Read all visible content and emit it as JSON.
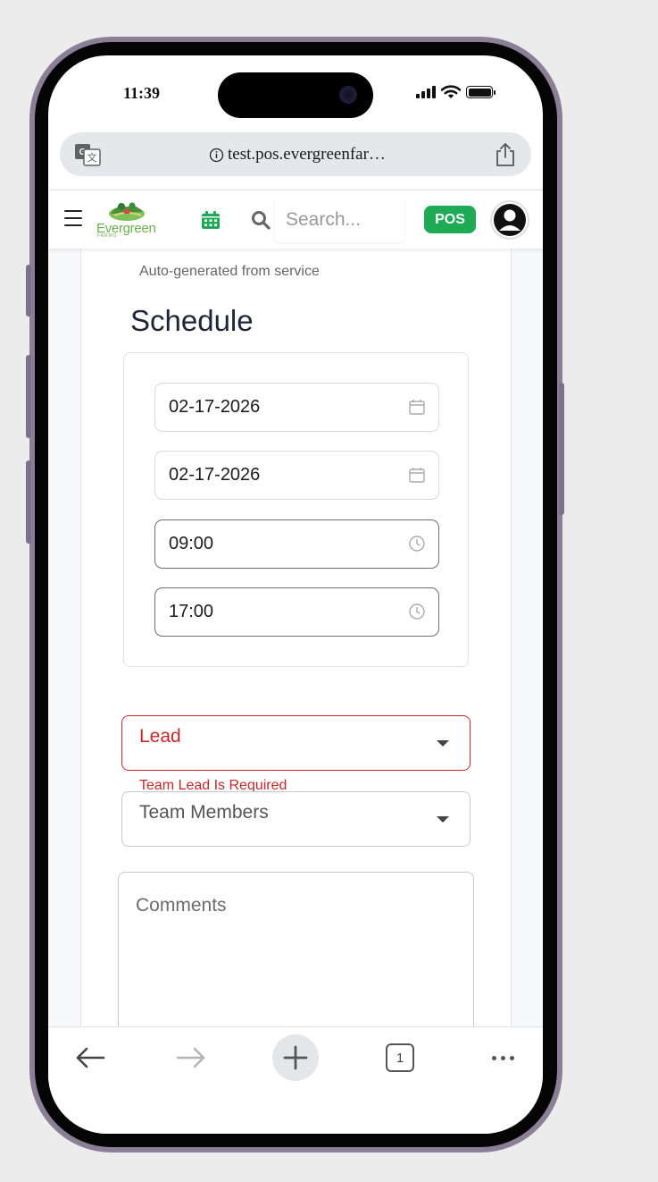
{
  "status_bar": {
    "time": "11:39"
  },
  "browser": {
    "url": "test.pos.evergreenfar…",
    "tab_count": "1"
  },
  "header": {
    "logo_text": "Evergreen",
    "logo_subtext": "FARMS",
    "search_placeholder": "Search...",
    "pos_label": "POS"
  },
  "form": {
    "helper_text": "Auto-generated from service",
    "schedule_title": "Schedule",
    "start_date": "02-17-2026",
    "end_date": "02-17-2026",
    "start_time": "09:00",
    "end_time": "17:00",
    "lead_label": "Lead",
    "lead_error": "Team Lead Is Required",
    "team_members_label": "Team Members",
    "comments_placeholder": "Comments"
  },
  "colors": {
    "brand_green": "#1faa55",
    "error_red": "#c62828",
    "logo_green": "#6ab04c"
  },
  "icons": [
    "translate-icon",
    "info-icon",
    "share-icon",
    "menu-icon",
    "calendar-icon",
    "search-icon",
    "avatar-icon",
    "date-icon",
    "clock-icon",
    "chevron-down-icon",
    "back-arrow-icon",
    "forward-arrow-icon",
    "plus-icon",
    "more-icon"
  ]
}
